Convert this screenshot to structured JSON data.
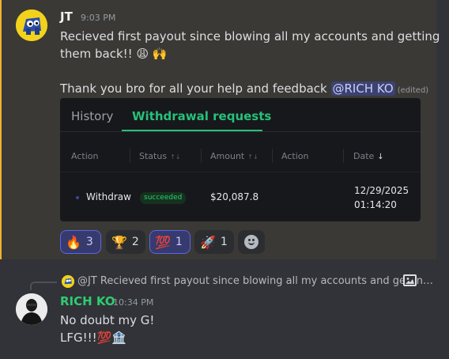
{
  "messages": [
    {
      "author": "JT",
      "time": "9:03 PM",
      "lines": [
        "Recieved first payout since blowing all my accounts and getting",
        "them back!! 😩 🙌"
      ],
      "thanks_text": "Thank you bro for all your help and feedback ",
      "mention": "@RICH KO",
      "edited": "(edited)",
      "attachment": {
        "tabs": [
          "History",
          "Withdrawal requests"
        ],
        "active_tab": "Withdrawal requests",
        "columns": [
          "Action",
          "Status",
          "Amount",
          "Action",
          "Date"
        ],
        "row": {
          "action": "Withdraw",
          "status": "succeeded",
          "amount": "$20,087.8",
          "date": "12/29/2025",
          "time": "01:14:20"
        }
      },
      "reactions": [
        {
          "emoji": "🔥",
          "count": "3",
          "mine": true
        },
        {
          "emoji": "🏆",
          "count": "2",
          "mine": false
        },
        {
          "emoji": "💯",
          "count": "1",
          "mine": true
        },
        {
          "emoji": "🚀",
          "count": "1",
          "mine": false
        }
      ]
    },
    {
      "reply_preview": "@JT Recieved first payout since blowing all my accounts and gettin…",
      "author": "RICH KO",
      "author_color": "#2ecc71",
      "time": "10:34 PM",
      "lines": [
        "No doubt my G!",
        "LFG!!!💯🏦"
      ]
    }
  ],
  "icons": {
    "add_reaction": "smile-plus-icon",
    "reply_image": "image-icon",
    "sort": "sort-arrows-icon"
  },
  "colors": {
    "mention_highlight": "#f0b232",
    "accent_green": "#27c07a"
  }
}
